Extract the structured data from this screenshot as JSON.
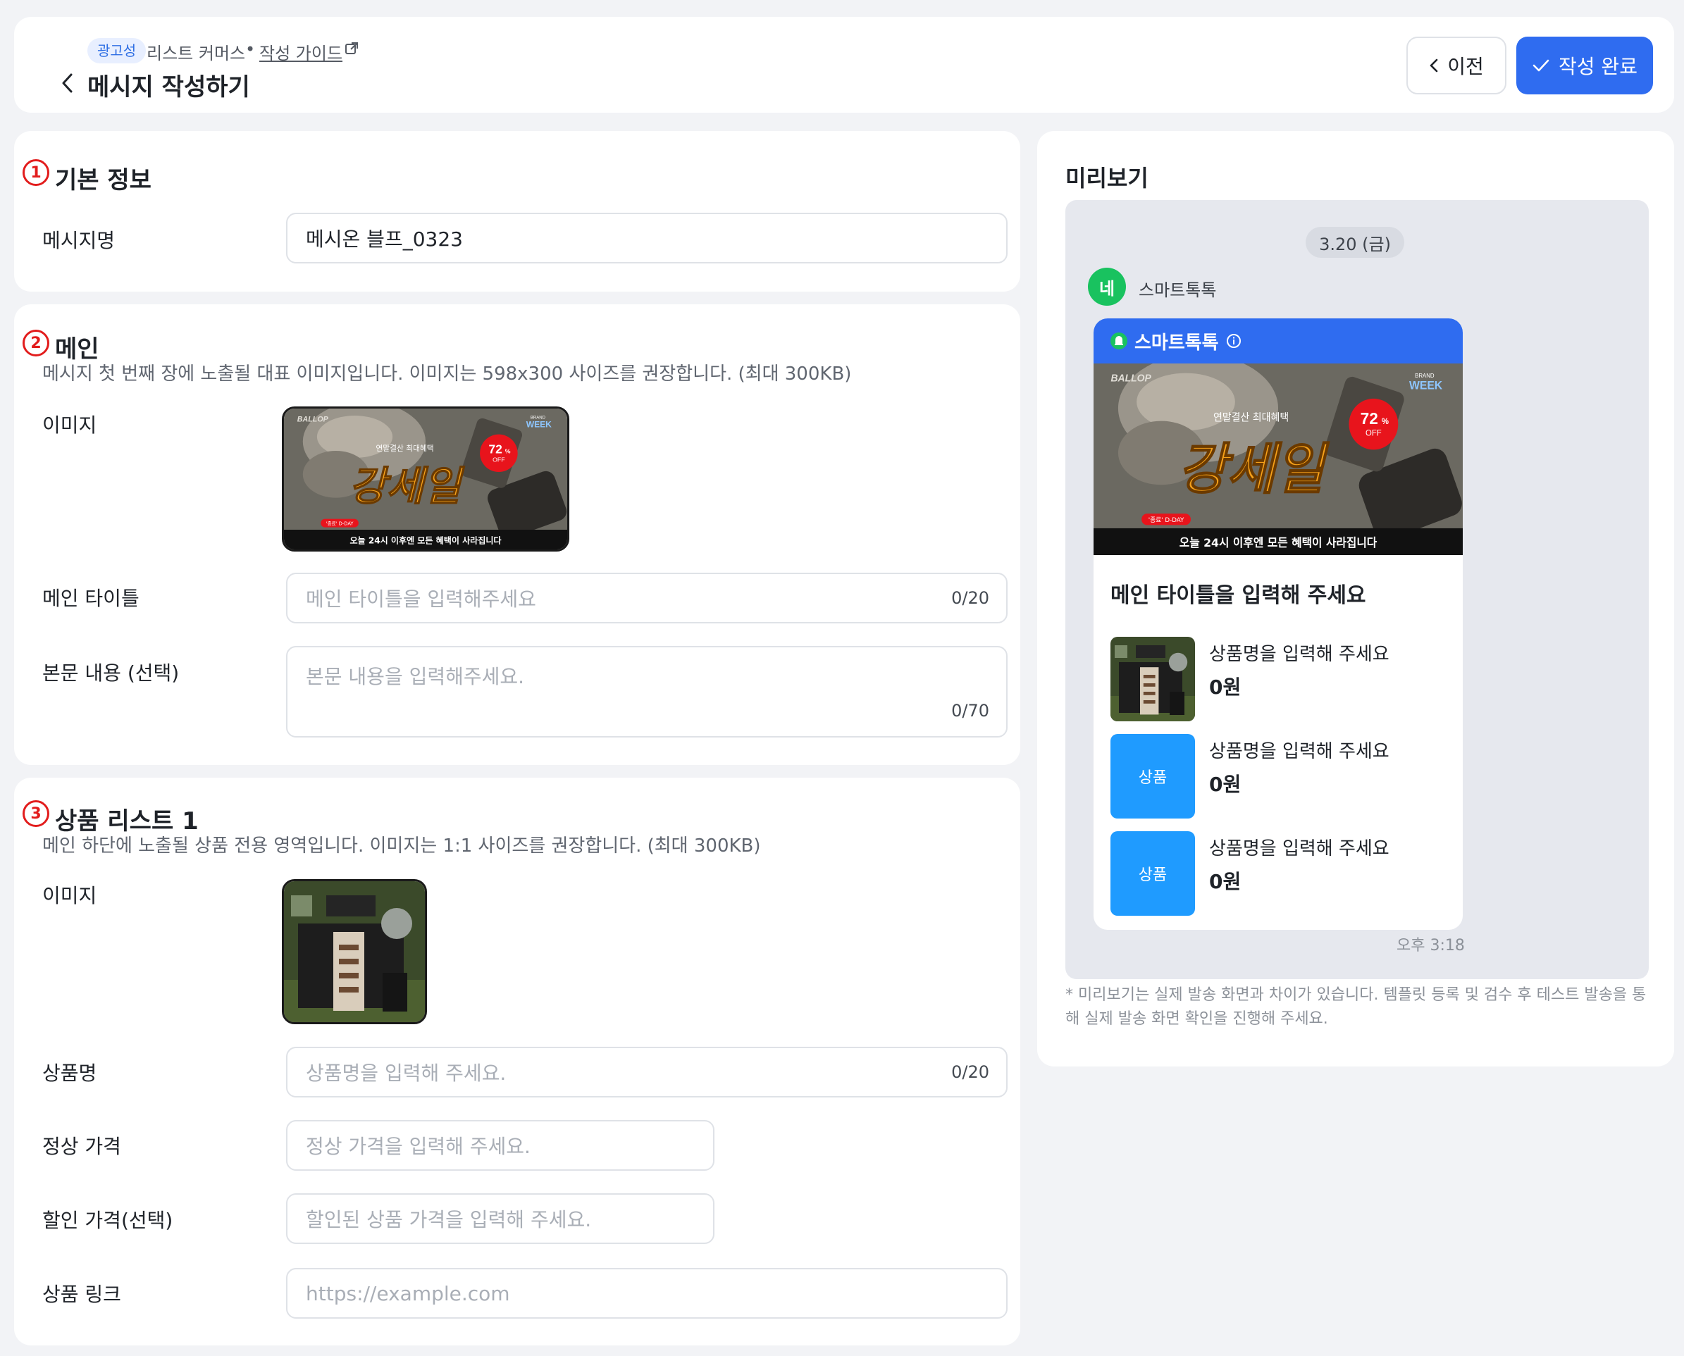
{
  "header": {
    "badge": "광고성",
    "category": "리스트 커머스",
    "separator": "•",
    "guide_link": "작성 가이드",
    "title": "메시지 작성하기",
    "prev_label": "이전",
    "done_label": "작성 완료",
    "accent": "#2f6cf0"
  },
  "sections": {
    "basic": {
      "num": "1",
      "title": "기본 정보",
      "message_name_label": "메시지명",
      "message_name_value": "메시온 블프_0323"
    },
    "main": {
      "num": "2",
      "title": "메인",
      "desc": "메시지 첫 번째 장에 노출될 대표 이미지입니다. 이미지는 598x300 사이즈를 권장합니다. (최대 300KB)",
      "image_label": "이미지",
      "title_label": "메인 타이틀",
      "title_placeholder": "메인 타이틀을 입력해주세요",
      "title_counter": "0/20",
      "body_label": "본문 내용 (선택)",
      "body_placeholder": "본문 내용을 입력해주세요.",
      "body_counter": "0/70"
    },
    "product": {
      "num": "3",
      "title": "상품 리스트 1",
      "desc": "메인 하단에 노출될 상품 전용 영역입니다. 이미지는 1:1 사이즈를 권장합니다. (최대 300KB)",
      "image_label": "이미지",
      "name_label": "상품명",
      "name_placeholder": "상품명을 입력해 주세요.",
      "name_counter": "0/20",
      "price_label": "정상 가격",
      "price_placeholder": "정상 가격을 입력해 주세요.",
      "discount_label": "할인 가격(선택)",
      "discount_placeholder": "할인된 상품 가격을 입력해 주세요.",
      "link_label": "상품 링크",
      "link_placeholder": "https://example.com"
    }
  },
  "banner": {
    "brand": "BALLOP",
    "brand_badge_top": "BRAND",
    "brand_badge": "WEEK",
    "headline_small": "연말결산 최대혜택",
    "headline": "강세일",
    "discount": "72",
    "discount_unit": "%",
    "off": "OFF",
    "dday": "'종료' D-DAY",
    "bottom_text": "오늘 24시 이후엔 모든 혜택이 사라집니다"
  },
  "preview": {
    "title": "미리보기",
    "date": "3.20 (금)",
    "sender_avatar": "네",
    "sender_name": "스마트톡톡",
    "channel_name": "스마트톡톡",
    "main_title": "메인 타이틀을 입력해 주세요",
    "items": [
      {
        "name": "상품명을 입력해 주세요",
        "price": "0원",
        "thumb": ""
      },
      {
        "name": "상품명을 입력해 주세요",
        "price": "0원",
        "thumb": "상품"
      },
      {
        "name": "상품명을 입력해 주세요",
        "price": "0원",
        "thumb": "상품"
      }
    ],
    "time": "오후 3:18",
    "note": "* 미리보기는 실제 발송 화면과 차이가 있습니다. 템플릿 등록 및 검수 후 테스트 발송을 통해 실제 발송 화면 확인을 진행해 주세요."
  }
}
